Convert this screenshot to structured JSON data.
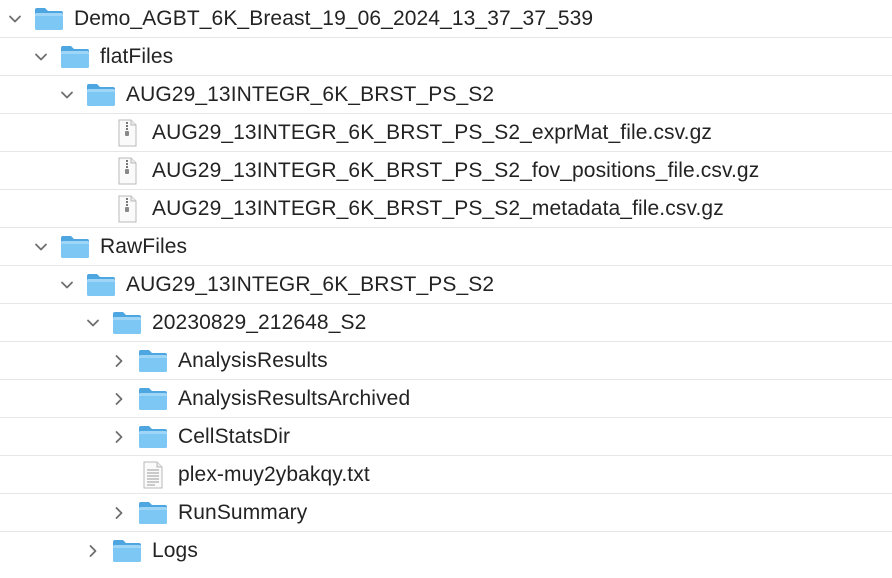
{
  "tree": {
    "rows": [
      {
        "label": "Demo_AGBT_6K_Breast_19_06_2024_13_37_37_539",
        "type": "folder",
        "state": "expanded"
      },
      {
        "label": "flatFiles",
        "type": "folder",
        "state": "expanded"
      },
      {
        "label": "AUG29_13INTEGR_6K_BRST_PS_S2",
        "type": "folder",
        "state": "expanded"
      },
      {
        "label": "AUG29_13INTEGR_6K_BRST_PS_S2_exprMat_file.csv.gz",
        "type": "archive-file",
        "state": "none"
      },
      {
        "label": "AUG29_13INTEGR_6K_BRST_PS_S2_fov_positions_file.csv.gz",
        "type": "archive-file",
        "state": "none"
      },
      {
        "label": "AUG29_13INTEGR_6K_BRST_PS_S2_metadata_file.csv.gz",
        "type": "archive-file",
        "state": "none"
      },
      {
        "label": "RawFiles",
        "type": "folder",
        "state": "expanded"
      },
      {
        "label": "AUG29_13INTEGR_6K_BRST_PS_S2",
        "type": "folder",
        "state": "expanded"
      },
      {
        "label": "20230829_212648_S2",
        "type": "folder",
        "state": "expanded"
      },
      {
        "label": "AnalysisResults",
        "type": "folder",
        "state": "collapsed"
      },
      {
        "label": "AnalysisResultsArchived",
        "type": "folder",
        "state": "collapsed"
      },
      {
        "label": "CellStatsDir",
        "type": "folder",
        "state": "collapsed"
      },
      {
        "label": "plex-muy2ybakqy.txt",
        "type": "text-file",
        "state": "none"
      },
      {
        "label": "RunSummary",
        "type": "folder",
        "state": "collapsed"
      },
      {
        "label": "Logs",
        "type": "folder",
        "state": "collapsed"
      }
    ]
  },
  "colors": {
    "folder_back": "#5fb4ea",
    "folder_front": "#7dc7f4",
    "folder_tab": "#4da6e0",
    "chevron": "#6e6e6e",
    "separator": "#e6e6e6",
    "text": "#232323"
  }
}
